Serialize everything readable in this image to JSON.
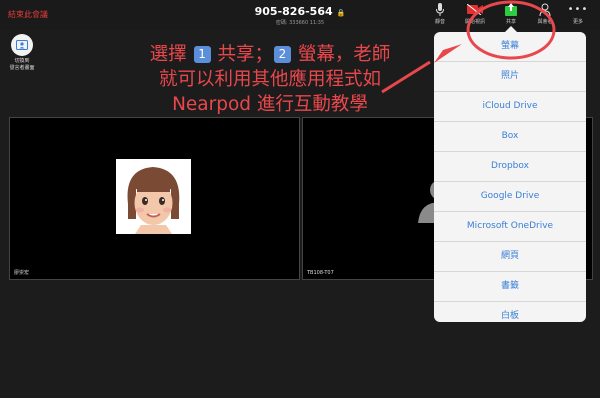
{
  "topbar": {
    "end_meeting_label": "結束此會議",
    "meeting_id": "905-826-564",
    "meeting_sub": "密碼: 333660   11:35",
    "tools": [
      {
        "label": "靜音",
        "icon": "microphone-icon"
      },
      {
        "label": "開始視訊",
        "icon": "video-icon"
      },
      {
        "label": "共享",
        "icon": "share-icon"
      },
      {
        "label": "與會者",
        "icon": "participants-icon"
      },
      {
        "label": "更多",
        "icon": "more-icon"
      }
    ]
  },
  "switch_view": {
    "line1": "切換到",
    "line2": "發言者畫面",
    "icon": "speaker-view-icon"
  },
  "video_tiles": [
    {
      "name": "廖崇宏"
    },
    {
      "name": "TB108-T07"
    }
  ],
  "annotation": {
    "line1_a": "選擇",
    "step1_num": "1",
    "line1_b": "共享；",
    "step2_num": "2",
    "line1_c": "螢幕，老師",
    "line2": "就可以利用其他應用程式如",
    "line3": "Nearpod 進行互動教學"
  },
  "share_menu": {
    "items": [
      "螢幕",
      "照片",
      "iCloud Drive",
      "Box",
      "Dropbox",
      "Google Drive",
      "Microsoft OneDrive",
      "網頁",
      "書籤",
      "白板"
    ]
  },
  "colors": {
    "annotation": "#e8474c",
    "menu_text": "#3a7fd6",
    "end_meeting": "#e23b3b",
    "share_icon": "#2ecc40"
  }
}
